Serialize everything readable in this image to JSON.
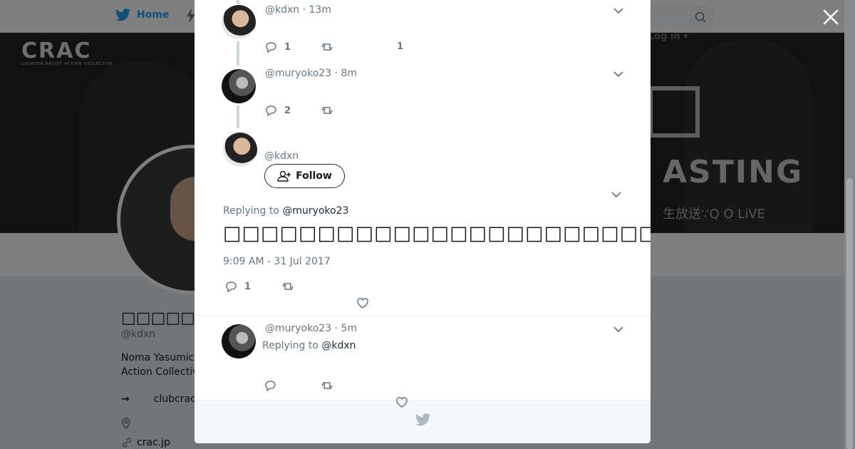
{
  "nav": {
    "home_label": "Home",
    "login_label": "Log in ▾"
  },
  "banner": {
    "logo": "CRAC",
    "logo_sub": "COUNTER-RACIST ACTION COLLECTIVE",
    "banner_text": "ASTING",
    "banner_text2": "生放送∵Q  O LiVE"
  },
  "profile": {
    "name": "□□□□□",
    "handle": "@kdxn",
    "bio": "Noma Yasumic Action Collectiv",
    "link_arrow": "→",
    "link1": "clubcrac",
    "link2": "crac.jp"
  },
  "thread": [
    {
      "handle": "@kdxn",
      "time": "13m",
      "reply_count": "1",
      "like_count": "1"
    },
    {
      "handle": "@muryoko23",
      "time": "8m",
      "reply_count": "2",
      "like_count": ""
    }
  ],
  "focus": {
    "handle": "@kdxn",
    "follow_label": "Follow",
    "replying_prefix": "Replying to",
    "replying_handle": "@muryoko23",
    "text": "□□□□□□□□□□□□□□□□□□□□□□□□□□□□□□□□□□□□□□□□□□",
    "timestamp": "9:09 AM - 31 Jul 2017",
    "reply_count": "1"
  },
  "reply": {
    "handle": "@muryoko23",
    "time": "5m",
    "replying_prefix": "Replying to",
    "replying_handle": "@kdxn"
  },
  "sep": "·"
}
